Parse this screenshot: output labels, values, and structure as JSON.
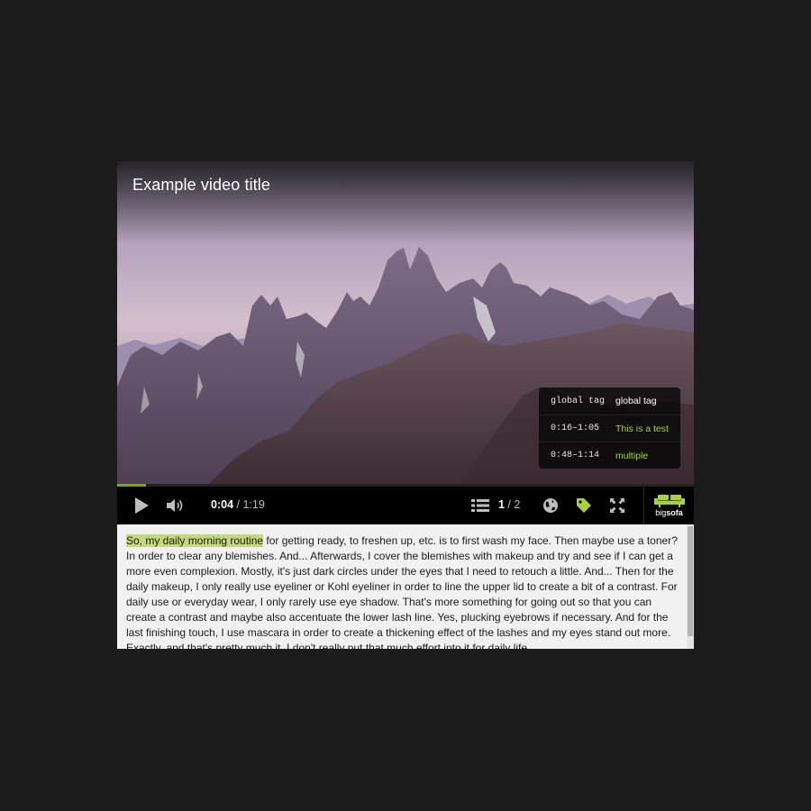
{
  "video": {
    "title": "Example video title"
  },
  "tags": [
    {
      "time": "global tag",
      "label": "global tag",
      "highlight": false
    },
    {
      "time": "0:16–1:05",
      "label": "This is a test",
      "highlight": true
    },
    {
      "time": "0:48–1:14",
      "label": "multiple",
      "highlight": true
    }
  ],
  "playback": {
    "current_time": "0:04",
    "separator": " / ",
    "duration": "1:19",
    "progress_fraction": 0.05
  },
  "chapters": {
    "current": "1",
    "separator": " / ",
    "total": "2"
  },
  "icons": {
    "play": "play-icon",
    "volume": "volume-icon",
    "list": "list-icon",
    "globe": "globe-icon",
    "tag": "tag-icon",
    "fullscreen": "fullscreen-icon",
    "brand": "sofa-logo-icon"
  },
  "brand": {
    "prefix": "big",
    "suffix": "sofa"
  },
  "transcript": {
    "highlighted": "So, my daily morning routine",
    "rest": " for getting ready, to freshen up, etc. is to first wash my face. Then maybe use a toner? In order to clear any blemishes. And... Afterwards, I cover the blemishes with makeup and try and see if I can get a more even complexion. Mostly, it's just dark circles under the eyes that I need to retouch a little. And... Then for the daily makeup, I only really use eyeliner or Kohl eyeliner in order to line the upper lid to create a bit of a contrast. For daily use or everyday wear, I only rarely use eye shadow. That's more something for going out so that you can create a contrast and maybe also accentuate the lower lash line. Yes, plucking eyebrows if necessary. And for the last finishing touch, I use mascara in order to create a thickening effect of the lashes and my eyes stand out more. Exactly, and that's pretty much it. I don't really put that much effort into it for daily life."
  },
  "colors": {
    "accent": "#a8cf45",
    "highlight": "#c2da7c",
    "page_background": "#1c1c1c",
    "controls_background": "#000000"
  }
}
